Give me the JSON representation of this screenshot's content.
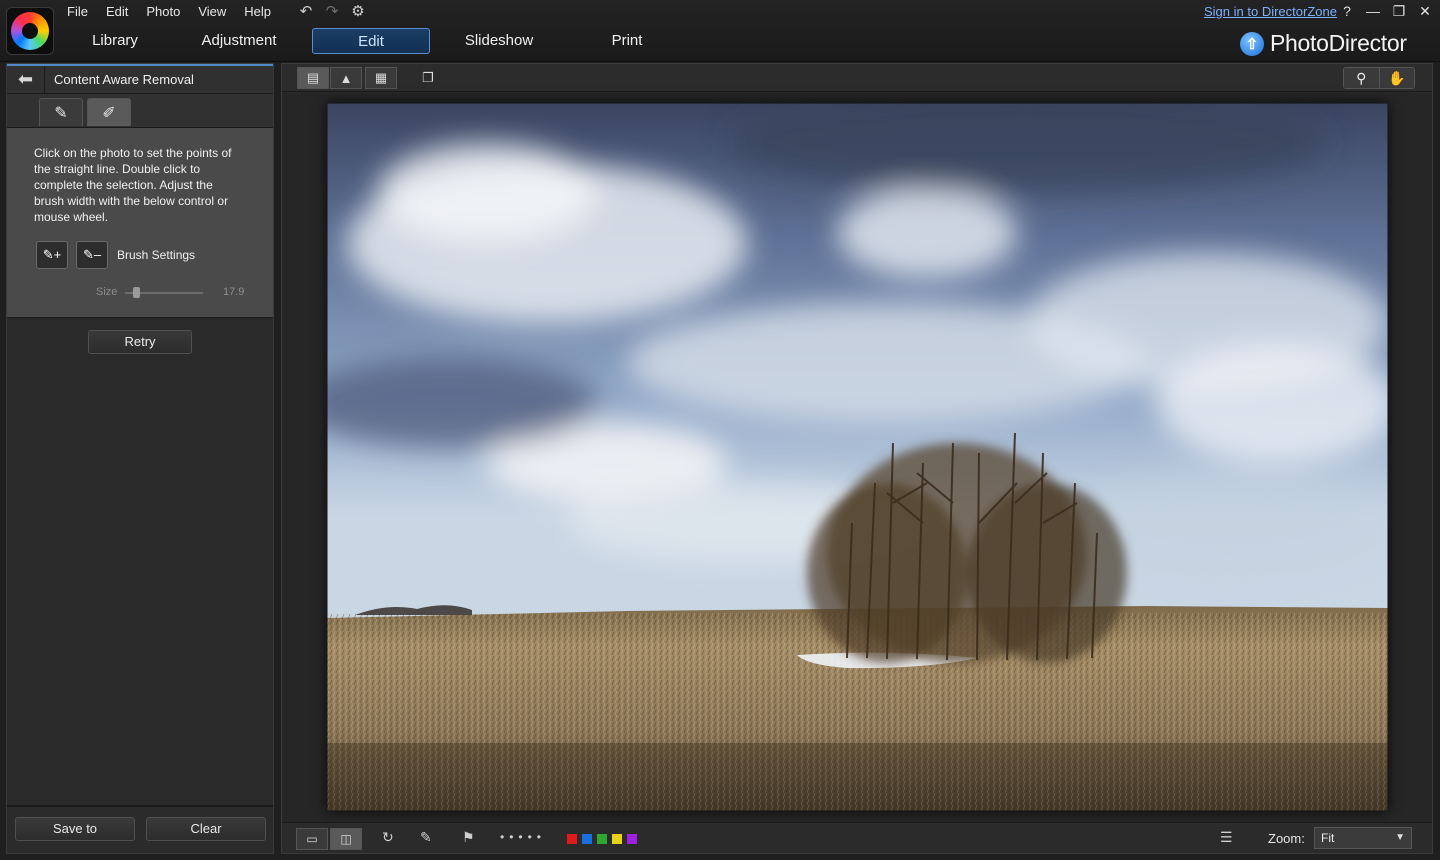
{
  "app": {
    "brand_name": "PhotoDirector",
    "menu": [
      "File",
      "Edit",
      "Photo",
      "View",
      "Help"
    ],
    "tabs": [
      {
        "label": "Library",
        "active": false
      },
      {
        "label": "Adjustment",
        "active": false
      },
      {
        "label": "Edit",
        "active": true
      },
      {
        "label": "Slideshow",
        "active": false
      },
      {
        "label": "Print",
        "active": false
      }
    ],
    "signin_link": "Sign in to DirectorZone",
    "help": "?",
    "accent_color": "#4f89c9"
  },
  "left_panel": {
    "title": "Content Aware Removal",
    "instructions": "Click on the photo to set the points of the straight line. Double click to complete the selection. Adjust the brush width with the below control or mouse wheel.",
    "brush_settings_label": "Brush Settings",
    "size_label": "Size",
    "size_value": "17.9",
    "size_fraction": 0.1,
    "retry_label": "Retry",
    "save_to_label": "Save to",
    "clear_label": "Clear"
  },
  "status_bar": {
    "zoom_label": "Zoom:",
    "zoom_value": "Fit",
    "color_labels": [
      "#e01b1b",
      "#1a6fe0",
      "#2fa82f",
      "#e8d21a",
      "#a020e0"
    ]
  }
}
